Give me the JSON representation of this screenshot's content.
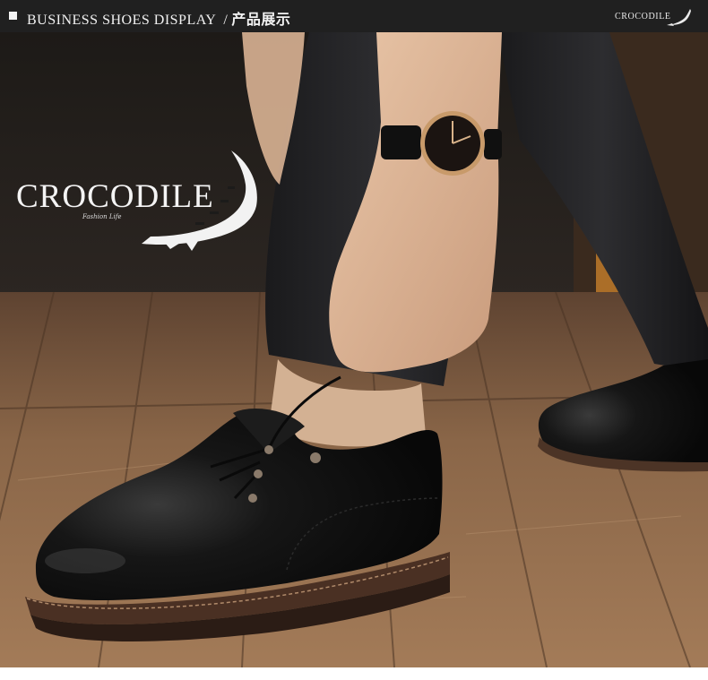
{
  "header": {
    "title_en": "BUSINESS SHOES DISPLAY",
    "separator": "/",
    "title_cn": "产品展示",
    "brand": "CROCODILE"
  },
  "photo": {
    "logo_text": "CROCODILE",
    "logo_tagline": "Fashion Life",
    "logo_icon": "crocodile-icon"
  },
  "colors": {
    "header_bg": "#202020",
    "header_text": "#f2f2f2",
    "shoe_leather": "#141414",
    "sole": "#5a3a28",
    "floor_wood": "#9b7554"
  }
}
